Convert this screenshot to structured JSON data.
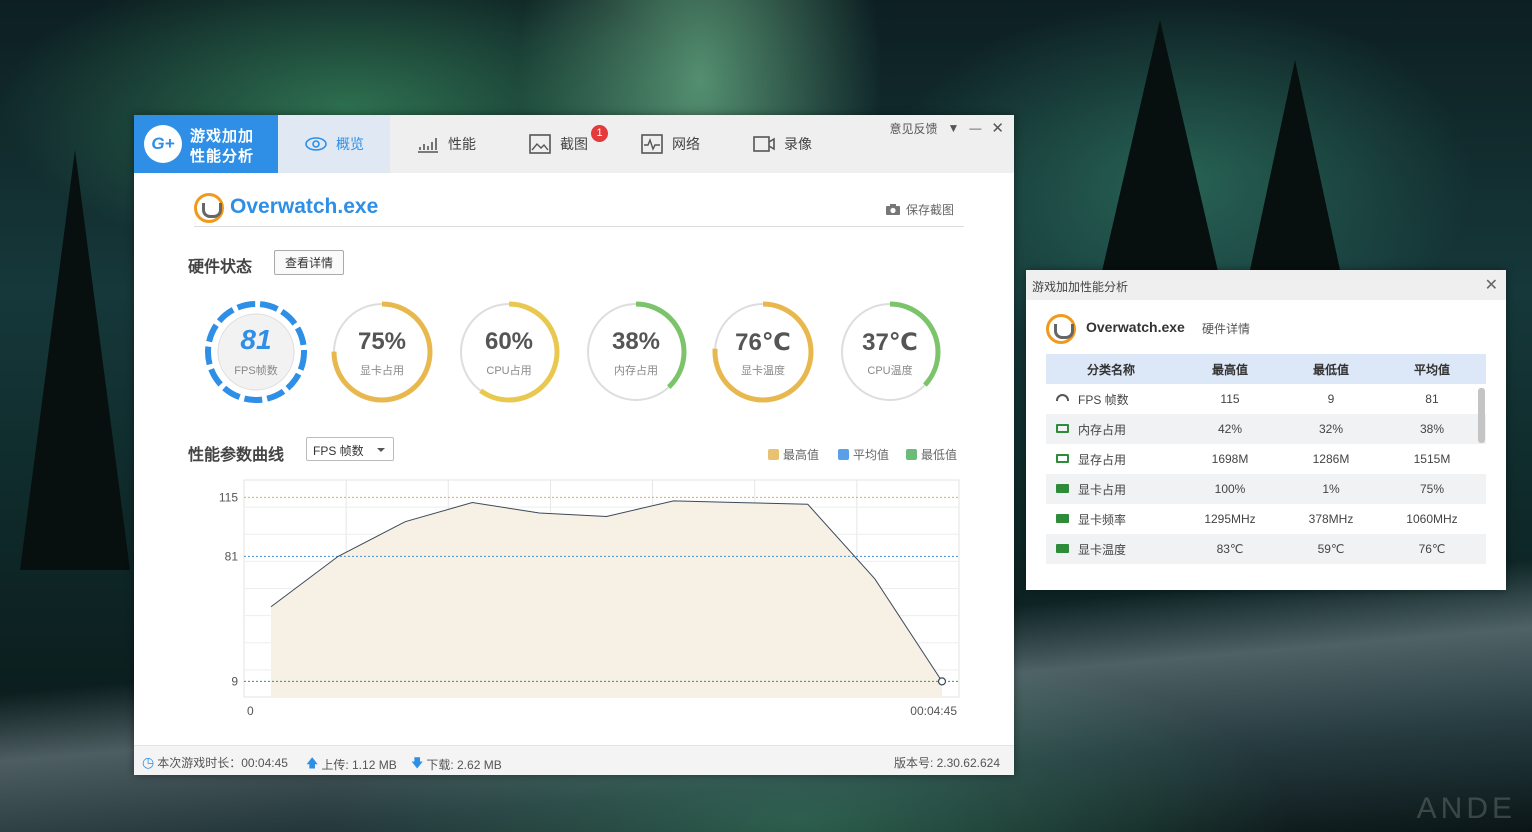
{
  "main": {
    "logo": {
      "badge": "G+",
      "line1": "游戏加加",
      "line2": "性能分析"
    },
    "tabs": [
      {
        "label": "概览",
        "active": true
      },
      {
        "label": "性能"
      },
      {
        "label": "截图",
        "badge": "1"
      },
      {
        "label": "网络"
      },
      {
        "label": "录像"
      }
    ],
    "window_controls": {
      "feedback": "意见反馈"
    },
    "app_title": "Overwatch.exe",
    "save_screenshot": "保存截图",
    "hardware_status": "硬件状态",
    "view_details": "查看详情",
    "gauges": [
      {
        "value": "81",
        "label": "FPS帧数",
        "type": "fps"
      },
      {
        "value": "75%",
        "label": "显卡占用",
        "percent": 75,
        "color": "#e8b84e"
      },
      {
        "value": "60%",
        "label": "CPU占用",
        "percent": 60,
        "color": "#e8c84e"
      },
      {
        "value": "38%",
        "label": "内存占用",
        "percent": 38,
        "color": "#7bc46a"
      },
      {
        "value": "76℃",
        "label": "显卡温度",
        "percent": 76,
        "color": "#e8b84e"
      },
      {
        "value": "37℃",
        "label": "CPU温度",
        "percent": 37,
        "color": "#7bc46a"
      }
    ],
    "curve_title": "性能参数曲线",
    "curve_select": "FPS 帧数",
    "legend": [
      {
        "label": "最高值",
        "color": "#e8c173"
      },
      {
        "label": "平均值",
        "color": "#5aa0e8"
      },
      {
        "label": "最低值",
        "color": "#6dbb7a"
      }
    ],
    "status": {
      "duration": "本次游戏时长：00:04:45",
      "upload": "上传: 1.12 MB",
      "download": "下载: 2.62 MB",
      "version": "版本号:  2.30.62.624"
    }
  },
  "chart_data": {
    "type": "area",
    "series": [
      {
        "values": [
          52,
          81,
          101,
          112,
          106,
          104,
          113,
          112,
          111,
          68,
          9
        ]
      }
    ],
    "x_start_label": "0",
    "x_end_label": "00:04:45",
    "ref_lines": [
      115,
      81,
      9
    ],
    "ylim": [
      0,
      125
    ],
    "colors": {
      "max": "#f0a848",
      "avg": "#4a90d0",
      "min": "#2e9a6a",
      "fill": "#f7f0e4",
      "line": "#3a4a5a"
    }
  },
  "detail": {
    "title": "游戏加加性能分析",
    "app": "Overwatch.exe",
    "sub": "硬件详情",
    "headers": [
      "分类名称",
      "最高值",
      "最低值",
      "平均值"
    ],
    "rows": [
      {
        "name": "FPS 帧数",
        "icon": "gauge-icon",
        "max": "115",
        "min": "9",
        "avg": "81"
      },
      {
        "name": "内存占用",
        "icon": "memory-icon",
        "max": "42%",
        "min": "32%",
        "avg": "38%"
      },
      {
        "name": "显存占用",
        "icon": "vram-icon",
        "max": "1698M",
        "min": "1286M",
        "avg": "1515M"
      },
      {
        "name": "显卡占用",
        "icon": "gpu-icon",
        "max": "100%",
        "min": "1%",
        "avg": "75%"
      },
      {
        "name": "显卡频率",
        "icon": "gpu-icon",
        "max": "1295MHz",
        "min": "378MHz",
        "avg": "1060MHz"
      },
      {
        "name": "显卡温度",
        "icon": "gpu-icon",
        "max": "83℃",
        "min": "59℃",
        "avg": "76℃"
      }
    ]
  }
}
